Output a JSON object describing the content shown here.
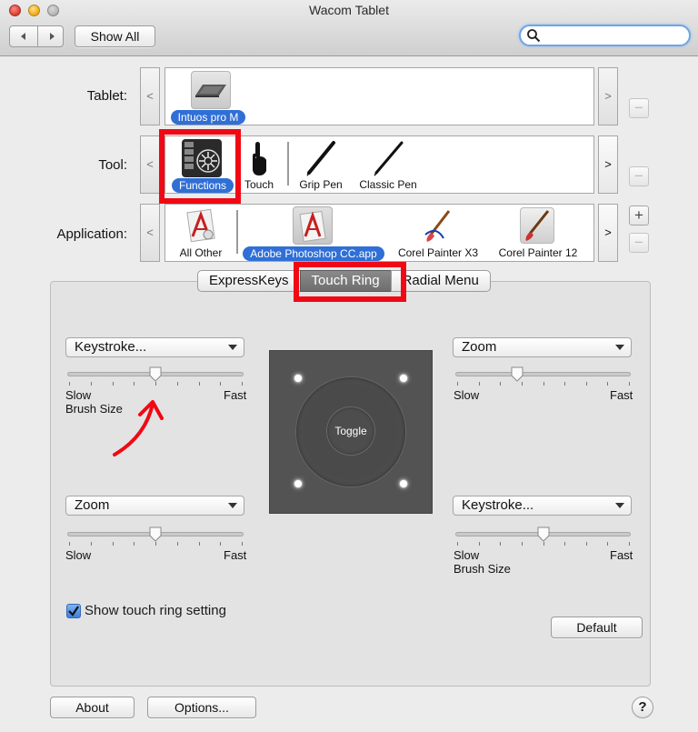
{
  "window": {
    "title": "Wacom Tablet"
  },
  "toolbar": {
    "back_icon": "back-arrow-icon",
    "forward_icon": "forward-arrow-icon",
    "show_all": "Show All",
    "search_placeholder": ""
  },
  "tablet_row": {
    "label": "Tablet:",
    "items": [
      {
        "label": "Intuos pro M",
        "selected": true,
        "icon": "tablet-icon"
      }
    ]
  },
  "tool_row": {
    "label": "Tool:",
    "items": [
      {
        "label": "Functions",
        "selected": true,
        "icon": "functions-icon"
      },
      {
        "label": "Touch",
        "selected": false,
        "icon": "touch-hand-icon"
      },
      {
        "label": "Grip Pen",
        "selected": false,
        "icon": "grip-pen-icon"
      },
      {
        "label": "Classic Pen",
        "selected": false,
        "icon": "classic-pen-icon"
      }
    ]
  },
  "application_row": {
    "label": "Application:",
    "items": [
      {
        "label": "All Other",
        "selected": false,
        "icon": "all-other-app-icon"
      },
      {
        "label": "Adobe Photoshop CC.app",
        "selected": true,
        "icon": "photoshop-app-icon"
      },
      {
        "label": "Corel Painter X3",
        "selected": false,
        "icon": "painter-brush-icon"
      },
      {
        "label": "Corel Painter 12",
        "selected": false,
        "icon": "painter-brush-icon"
      }
    ]
  },
  "nav_arrows": {
    "left": "<",
    "right": ">"
  },
  "buttons": {
    "plus": "+",
    "minus": "−"
  },
  "tabs": [
    {
      "label": "ExpressKeys",
      "selected": false
    },
    {
      "label": "Touch Ring",
      "selected": true
    },
    {
      "label": "Radial Menu",
      "selected": false
    }
  ],
  "ring_settings": {
    "top_left": {
      "function": "Keystroke...",
      "slow": "Slow",
      "fast": "Fast",
      "name": "Brush Size",
      "level": 0.5
    },
    "top_right": {
      "function": "Zoom",
      "slow": "Slow",
      "fast": "Fast",
      "level": 0.34
    },
    "bottom_left": {
      "function": "Zoom",
      "slow": "Slow",
      "fast": "Fast",
      "level": 0.5
    },
    "bottom_right": {
      "function": "Keystroke...",
      "slow": "Slow",
      "fast": "Fast",
      "name": "Brush Size",
      "level": 0.5
    }
  },
  "touch_ring": {
    "center_label": "Toggle"
  },
  "show_setting": {
    "label": "Show touch ring setting",
    "checked": true
  },
  "default_button": "Default",
  "footer": {
    "about": "About",
    "options": "Options...",
    "help": "?"
  },
  "colors": {
    "accent": "#2f6fd6",
    "highlight": "#f00914",
    "ring_bg": "#535353"
  }
}
